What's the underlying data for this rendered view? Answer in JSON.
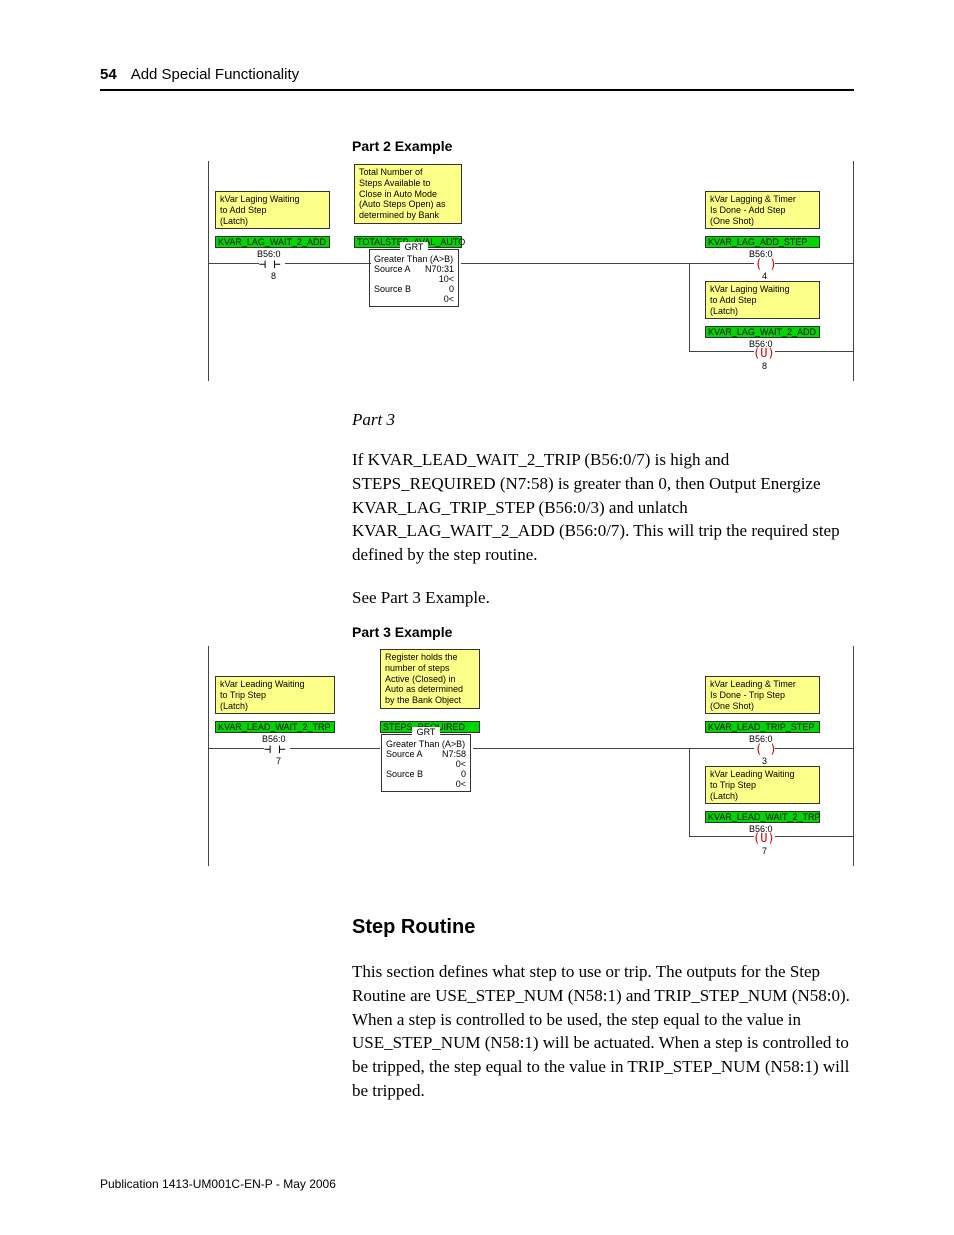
{
  "page": {
    "number": "54",
    "chapter": "Add Special Functionality"
  },
  "part2": {
    "caption": "Part 2 Example",
    "box_left": {
      "l1": "kVar Laging Waiting",
      "l2": "to Add Step",
      "l3": "(Latch)",
      "tag": "KVAR_LAG_WAIT_2_ADD",
      "addr": "B56:0",
      "bit": "8"
    },
    "box_mid": {
      "l1": "Total Number of",
      "l2": "Steps Available to",
      "l3": "Close in Auto Mode",
      "l4": "(Auto Steps Open) as",
      "l5": "determined by Bank",
      "tag": "TOTALSTEP_AVAL_AUTO"
    },
    "grt": {
      "title": "GRT",
      "sub": "Greater Than (A>B)",
      "sa": "Source A",
      "sav": "N70:31",
      "sav2": "10<",
      "sb": "Source B",
      "sbv": "0",
      "sbv2": "0<"
    },
    "box_right1": {
      "l1": "kVar Lagging & Timer",
      "l2": "Is Done - Add Step",
      "l3": "(One Shot)",
      "tag": "KVAR_LAG_ADD_STEP",
      "addr": "B56:0",
      "bit": "4"
    },
    "box_right2": {
      "l1": "kVar Laging Waiting",
      "l2": "to Add Step",
      "l3": "(Latch)",
      "tag": "KVAR_LAG_WAIT_2_ADD",
      "addr": "B56:0",
      "bit": "8"
    }
  },
  "part3": {
    "title": "Part 3",
    "para": "If KVAR_LEAD_WAIT_2_TRIP (B56:0/7) is high and STEPS_REQUIRED (N7:58) is greater than 0, then Output Energize KVAR_LAG_TRIP_STEP (B56:0/3) and unlatch KVAR_LAG_WAIT_2_ADD (B56:0/7). This will trip the required step defined by the step routine.",
    "see": "See Part 3 Example.",
    "caption": "Part 3 Example",
    "box_left": {
      "l1": "kVar Leading Waiting",
      "l2": "to Trip Step",
      "l3": "(Latch)",
      "tag": "KVAR_LEAD_WAIT_2_TRP",
      "addr": "B56:0",
      "bit": "7"
    },
    "box_mid": {
      "l1": "Register holds the",
      "l2": "number of steps",
      "l3": "Active (Closed) in",
      "l4": "Auto as determined",
      "l5": "by the Bank Object",
      "tag": "STEPS_REQUIRED"
    },
    "grt": {
      "title": "GRT",
      "sub": "Greater Than (A>B)",
      "sa": "Source A",
      "sav": "N7:58",
      "sav2": "0<",
      "sb": "Source B",
      "sbv": "0",
      "sbv2": "0<"
    },
    "box_right1": {
      "l1": "kVar Leading & Timer",
      "l2": "Is Done - Trip Step",
      "l3": "(One Shot)",
      "tag": "KVAR_LEAD_TRIP_STEP",
      "addr": "B56:0",
      "bit": "3"
    },
    "box_right2": {
      "l1": "kVar Leading Waiting",
      "l2": "to Trip Step",
      "l3": "(Latch)",
      "tag": "KVAR_LEAD_WAIT_2_TRP",
      "addr": "B56:0",
      "bit": "7"
    }
  },
  "step_routine": {
    "heading": "Step Routine",
    "para": "This section defines what step to use or trip. The outputs for the Step Routine are USE_STEP_NUM (N58:1) and TRIP_STEP_NUM (N58:0). When a step is controlled to be used, the step equal to the value in USE_STEP_NUM (N58:1) will be actuated. When a step is controlled to be tripped, the step equal to the value in TRIP_STEP_NUM (N58:1) will be tripped."
  },
  "footer": "Publication 1413-UM001C-EN-P - May 2006"
}
